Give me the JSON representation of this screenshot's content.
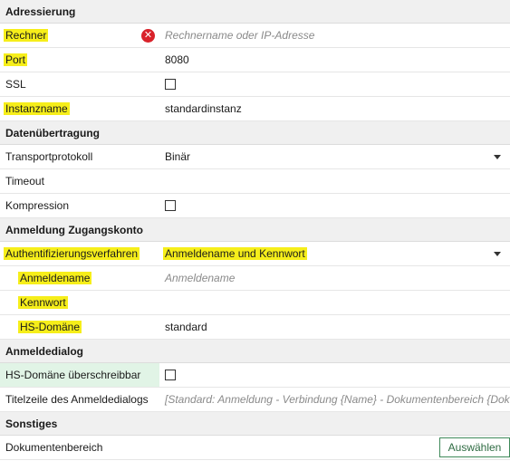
{
  "sections": {
    "addressing": "Adressierung",
    "transfer": "Datenübertragung",
    "login": "Anmeldung Zugangskonto",
    "dialog": "Anmeldedialog",
    "misc": "Sonstiges"
  },
  "rows": {
    "host": {
      "label": "Rechner",
      "placeholder": "Rechnername oder IP-Adresse"
    },
    "port": {
      "label": "Port",
      "value": "8080"
    },
    "ssl": {
      "label": "SSL",
      "checked": false
    },
    "instance": {
      "label": "Instanzname",
      "value": "standardinstanz"
    },
    "protocol": {
      "label": "Transportprotokoll",
      "value": "Binär"
    },
    "timeout": {
      "label": "Timeout",
      "value": ""
    },
    "compression": {
      "label": "Kompression",
      "checked": false
    },
    "auth_method": {
      "label": "Authentifizierungsverfahren",
      "value": "Anmeldename und Kennwort"
    },
    "username": {
      "label": "Anmeldename",
      "placeholder": "Anmeldename"
    },
    "password": {
      "label": "Kennwort",
      "value": ""
    },
    "hs_domain": {
      "label": "HS-Domäne",
      "value": "standard"
    },
    "hs_domain_override": {
      "label": "HS-Domäne überschreibbar",
      "checked": false
    },
    "dialog_title": {
      "label": "Titelzeile des Anmeldedialogs",
      "placeholder": "[Standard: Anmeldung - Verbindung {Name} - Dokumentenbereich {Dok"
    },
    "doc_area": {
      "label": "Dokumentenbereich",
      "button": "Auswählen"
    }
  },
  "colors": {
    "highlight": "#f6ee1a",
    "error": "#d9222a",
    "green_row": "#e1f4e6"
  },
  "icons": {
    "error": "error-circle-icon",
    "dropdown": "chevron-down-icon"
  }
}
